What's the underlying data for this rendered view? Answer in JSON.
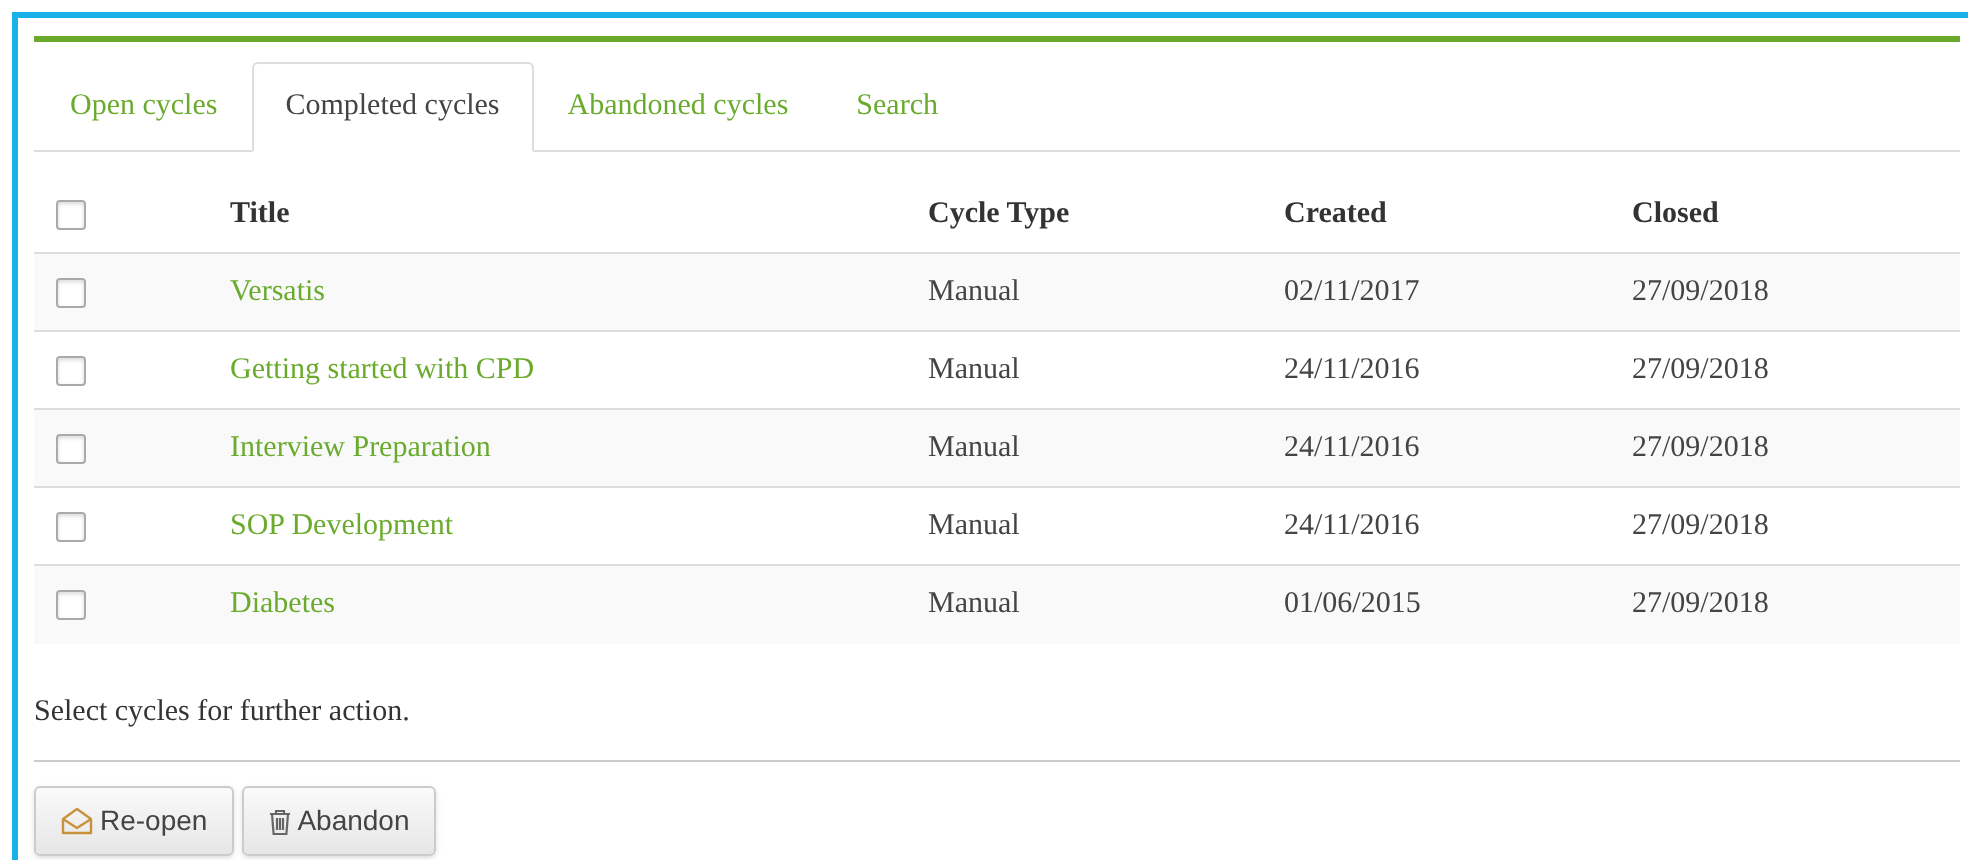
{
  "tabs": [
    {
      "label": "Open cycles",
      "selected": false
    },
    {
      "label": "Completed cycles",
      "selected": true
    },
    {
      "label": "Abandoned cycles",
      "selected": false
    },
    {
      "label": "Search",
      "selected": false
    }
  ],
  "table": {
    "select_all_checked": false,
    "columns": [
      "Title",
      "Cycle Type",
      "Created",
      "Closed"
    ],
    "rows": [
      {
        "checked": false,
        "cells": [
          "Versatis",
          "Manual",
          "02/11/2017",
          "27/09/2018"
        ]
      },
      {
        "checked": false,
        "cells": [
          "Getting started with CPD",
          "Manual",
          "24/11/2016",
          "27/09/2018"
        ]
      },
      {
        "checked": false,
        "cells": [
          "Interview Preparation",
          "Manual",
          "24/11/2016",
          "27/09/2018"
        ]
      },
      {
        "checked": false,
        "cells": [
          "SOP Development",
          "Manual",
          "24/11/2016",
          "27/09/2018"
        ]
      },
      {
        "checked": false,
        "cells": [
          "Diabetes",
          "Manual",
          "01/06/2015",
          "27/09/2018"
        ]
      }
    ]
  },
  "hint": "Select cycles for further action.",
  "buttons": [
    {
      "kind": "reopen",
      "label": "Re-open"
    },
    {
      "kind": "abandon",
      "label": "Abandon"
    }
  ]
}
